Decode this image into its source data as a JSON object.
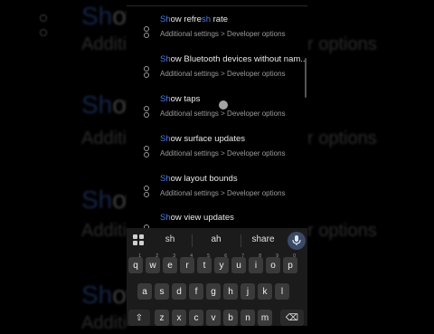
{
  "background": {
    "big_lines": [
      {
        "hl": "Sh",
        "rest": "ow"
      },
      {
        "hl": "Sh",
        "rest": "ow"
      },
      {
        "hl": "Sh",
        "rest": "ow"
      },
      {
        "hl": "Sh",
        "rest": "ow"
      }
    ],
    "sub_left": "Additi",
    "sub_right": [
      "r options",
      "r options",
      "r options",
      "r options"
    ]
  },
  "results": [
    {
      "title_hl": "Sh",
      "title_mid": "ow refre",
      "title_hl2": "sh",
      "title_rest": " rate",
      "path": "Additional settings > Developer options"
    },
    {
      "title_hl": "Sh",
      "title_mid": "ow Bluetooth devices without nam..",
      "title_hl2": "",
      "title_rest": "",
      "path": "Additional settings > Developer options"
    },
    {
      "title_hl": "Sh",
      "title_mid": "ow taps",
      "title_hl2": "",
      "title_rest": "",
      "path": "Additional settings > Developer options"
    },
    {
      "title_hl": "Sh",
      "title_mid": "ow surface updates",
      "title_hl2": "",
      "title_rest": "",
      "path": "Additional settings > Developer options"
    },
    {
      "title_hl": "Sh",
      "title_mid": "ow layout bounds",
      "title_hl2": "",
      "title_rest": "",
      "path": "Additional settings > Developer options"
    },
    {
      "title_hl": "Sh",
      "title_mid": "ow view updates",
      "title_hl2": "",
      "title_rest": "",
      "path": ""
    }
  ],
  "keyboard": {
    "suggestions": [
      "sh",
      "ah",
      "share"
    ],
    "row1": [
      [
        "q",
        "1"
      ],
      [
        "w",
        "2"
      ],
      [
        "e",
        "3"
      ],
      [
        "r",
        "4"
      ],
      [
        "t",
        "5"
      ],
      [
        "y",
        "6"
      ],
      [
        "u",
        "7"
      ],
      [
        "i",
        "8"
      ],
      [
        "o",
        "9"
      ],
      [
        "p",
        "0"
      ]
    ],
    "row2": [
      "a",
      "s",
      "d",
      "f",
      "g",
      "h",
      "j",
      "k",
      "l"
    ],
    "row3": [
      "z",
      "x",
      "c",
      "v",
      "b",
      "n",
      "m"
    ],
    "shift_label": "⇧",
    "backspace_label": "⌫"
  },
  "colors": {
    "highlight": "#4a7ee8",
    "background": "#000000",
    "key": "#3a3a3a"
  }
}
